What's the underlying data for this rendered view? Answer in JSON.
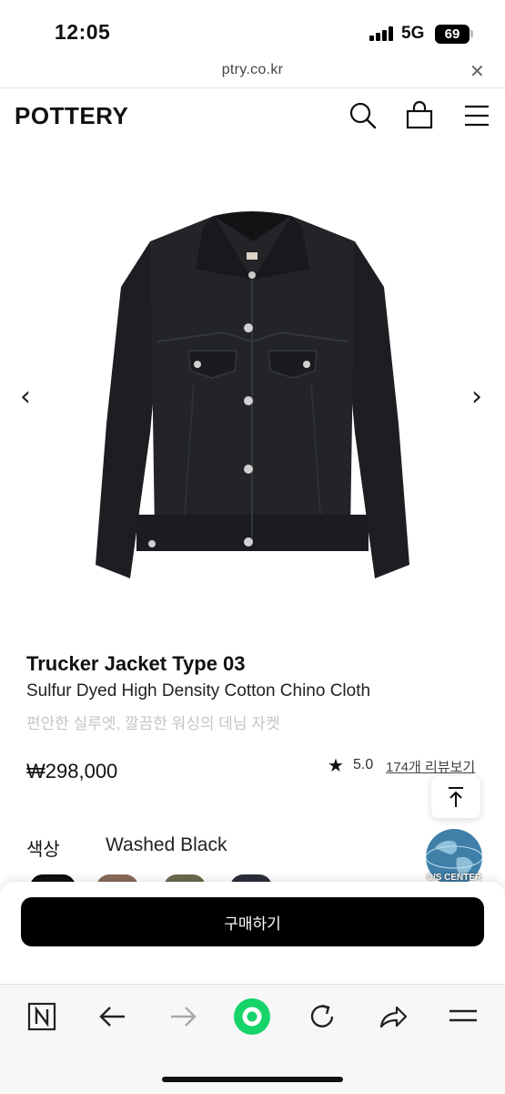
{
  "status": {
    "time": "12:05",
    "network": "5G",
    "battery": "69"
  },
  "browser": {
    "url": "ptry.co.kr"
  },
  "header": {
    "logo": "POTTERY",
    "icons": [
      "search-icon",
      "bag-icon",
      "menu-icon"
    ]
  },
  "product": {
    "image": "black-trucker-jacket",
    "title": "Trucker Jacket Type 03",
    "subtitle": "Sulfur Dyed High Density Cotton Chino Cloth",
    "description": "편안한 실루엣, 깔끔한 워싱의 데님 자켓",
    "price": "₩298,000",
    "rating": "5.0",
    "review_link": "174개 리뷰보기",
    "color_label": "색상",
    "color_value": "Washed Black",
    "swatch_colors": [
      "#111111",
      "#8a6a5a",
      "#6b6a4e",
      "#2a2e38"
    ]
  },
  "cs_badge": "C/S CENTER",
  "buy_button": "구매하기",
  "colors": {
    "accent_green": "#17d46a",
    "button_black": "#000000"
  },
  "toolbar_icons": [
    "naver-n-icon",
    "back-arrow-icon",
    "forward-arrow-icon",
    "green-home-icon",
    "refresh-icon",
    "share-icon",
    "menu-lines-icon"
  ]
}
